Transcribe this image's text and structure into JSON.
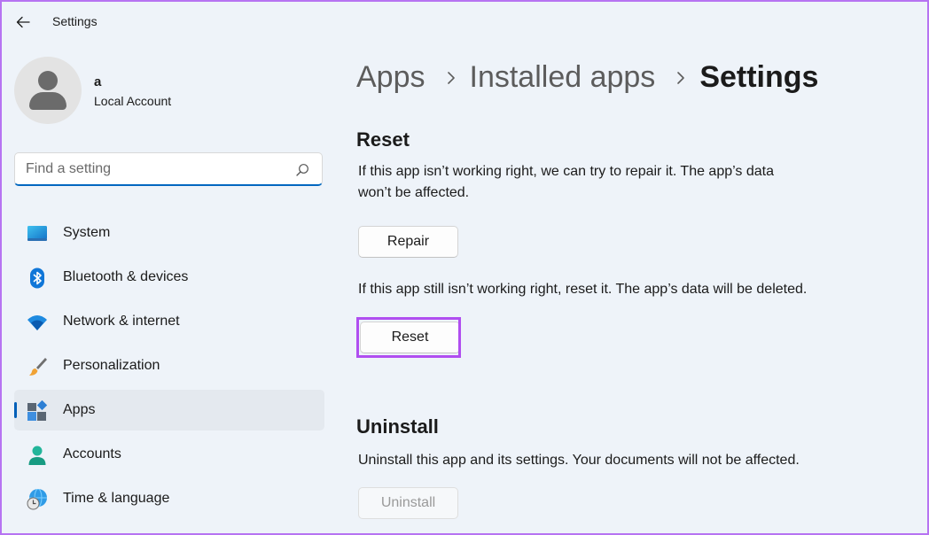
{
  "window": {
    "title": "Settings"
  },
  "profile": {
    "name": "a",
    "account_type": "Local Account"
  },
  "search": {
    "placeholder": "Find a setting",
    "value": ""
  },
  "nav": {
    "items": [
      {
        "label": "System",
        "icon": "monitor-icon"
      },
      {
        "label": "Bluetooth & devices",
        "icon": "bluetooth-icon"
      },
      {
        "label": "Network & internet",
        "icon": "wifi-icon"
      },
      {
        "label": "Personalization",
        "icon": "paintbrush-icon"
      },
      {
        "label": "Apps",
        "icon": "apps-icon",
        "selected": true
      },
      {
        "label": "Accounts",
        "icon": "person-icon"
      },
      {
        "label": "Time & language",
        "icon": "globe-clock-icon"
      }
    ]
  },
  "breadcrumb": {
    "items": [
      "Apps",
      "Installed apps",
      "Settings"
    ]
  },
  "reset_section": {
    "title": "Reset",
    "repair_desc_line1": "If this app isn’t working right, we can try to repair it. The app’s data",
    "repair_desc_line2": "won’t be affected.",
    "repair_label": "Repair",
    "reset_desc": "If this app still isn’t working right, reset it. The app’s data will be deleted.",
    "reset_label": "Reset"
  },
  "uninstall_section": {
    "title": "Uninstall",
    "desc": "Uninstall this app and its settings. Your documents will not be affected.",
    "uninstall_label": "Uninstall"
  },
  "colors": {
    "accent": "#005fb8",
    "highlight": "#b04ef0",
    "background": "#eef3f9"
  }
}
